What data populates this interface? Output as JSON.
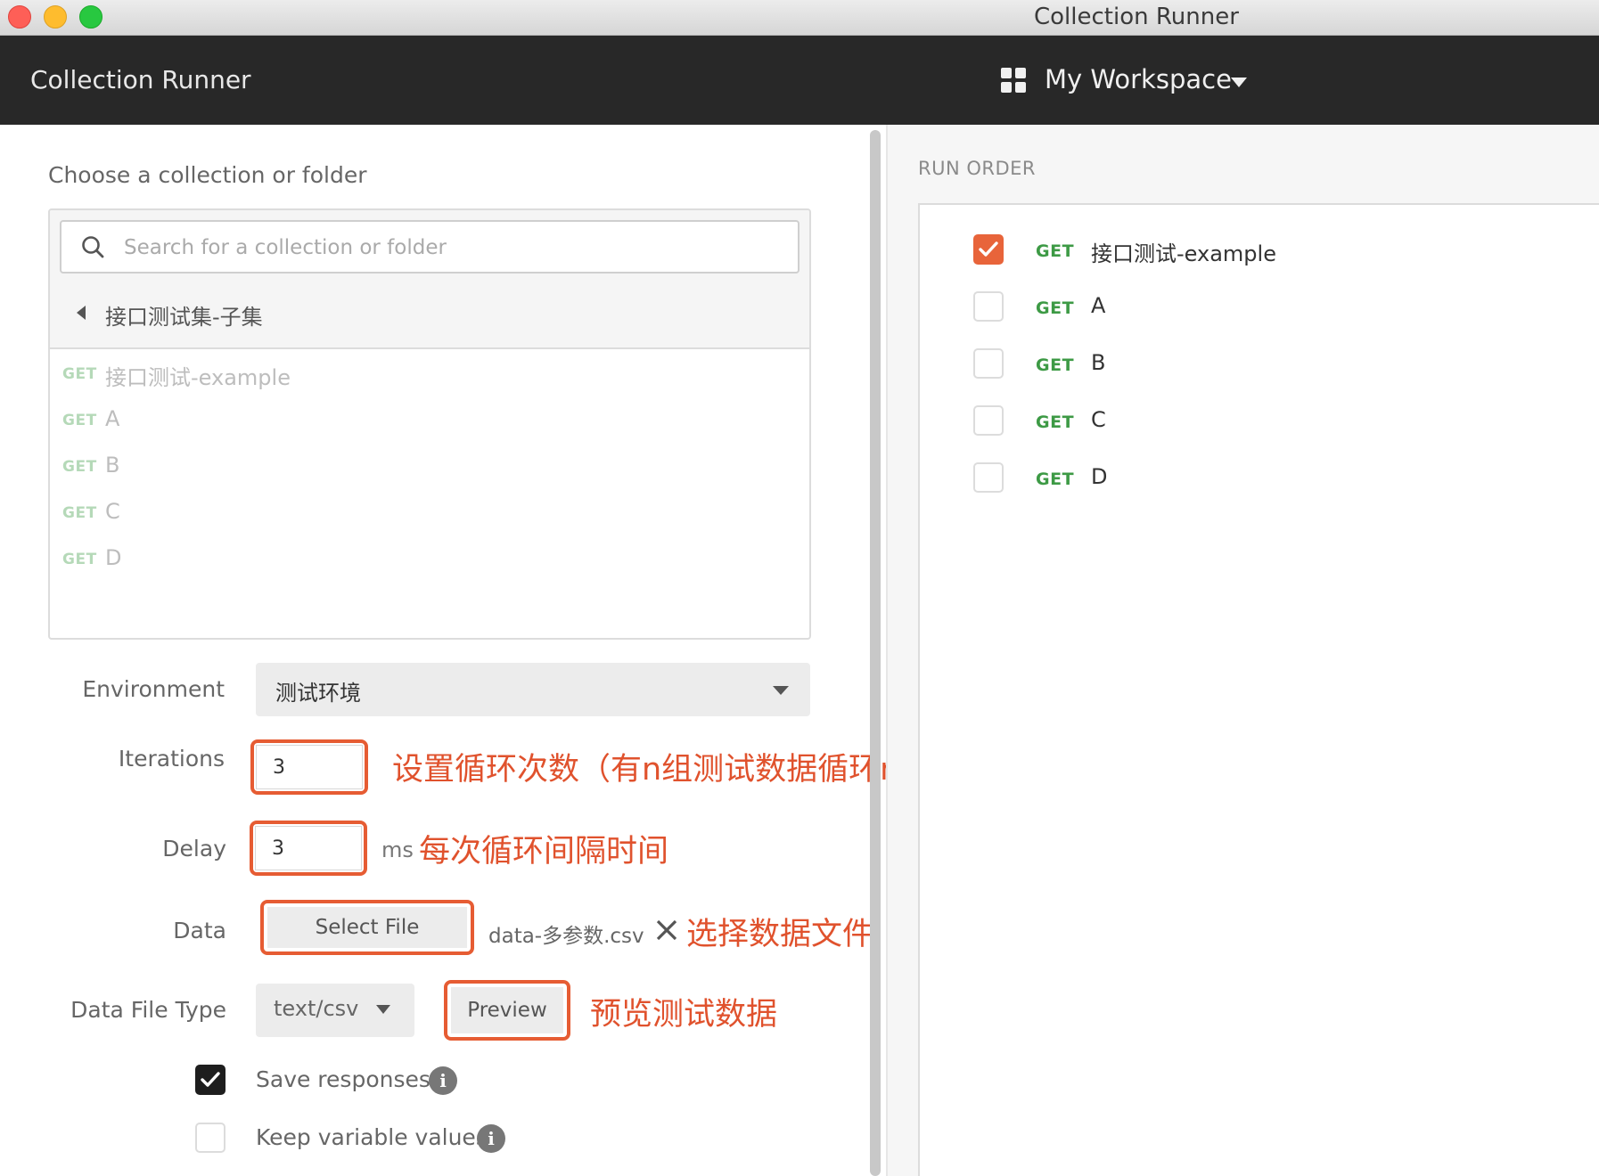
{
  "window": {
    "title": "Collection Runner"
  },
  "header": {
    "app_title": "Collection Runner",
    "workspace_label": "My Workspace"
  },
  "collection_picker": {
    "label": "Choose a collection or folder",
    "search_placeholder": "Search for a collection or folder",
    "current_folder": "接口测试集-子集",
    "requests": [
      {
        "method": "GET",
        "name": "接口测试-example"
      },
      {
        "method": "GET",
        "name": "A"
      },
      {
        "method": "GET",
        "name": "B"
      },
      {
        "method": "GET",
        "name": "C"
      },
      {
        "method": "GET",
        "name": "D"
      }
    ]
  },
  "form": {
    "environment_label": "Environment",
    "environment_value": "测试环境",
    "iterations_label": "Iterations",
    "iterations_value": "3",
    "delay_label": "Delay",
    "delay_value": "3",
    "delay_unit": "ms",
    "data_label": "Data",
    "select_file_label": "Select File",
    "file_name": "data-多参数.csv",
    "data_file_type_label": "Data File Type",
    "data_file_type_value": "text/csv",
    "preview_label": "Preview",
    "save_responses_label": "Save responses",
    "save_responses_checked": true,
    "keep_variable_values_label": "Keep variable values",
    "keep_variable_values_checked": false
  },
  "annotations": {
    "iterations_note": "设置循环次数（有n组测试数据循环n次）",
    "delay_note": "每次循环间隔时间",
    "data_note": "选择数据文件",
    "preview_note": "预览测试数据"
  },
  "run_order": {
    "label": "RUN ORDER",
    "items": [
      {
        "method": "GET",
        "name": "接口测试-example",
        "checked": true
      },
      {
        "method": "GET",
        "name": "A",
        "checked": false
      },
      {
        "method": "GET",
        "name": "B",
        "checked": false
      },
      {
        "method": "GET",
        "name": "C",
        "checked": false
      },
      {
        "method": "GET",
        "name": "D",
        "checked": false
      }
    ]
  },
  "colors": {
    "header_bg": "#282828",
    "accent_orange": "#e8643a",
    "annotation_red": "#e0522d",
    "get_green": "#3d9a45"
  }
}
